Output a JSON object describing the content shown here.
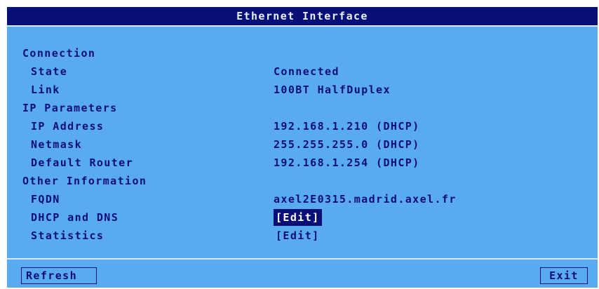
{
  "window": {
    "title": "Ethernet Interface"
  },
  "sections": {
    "connection": {
      "heading": "Connection",
      "state_label": "State",
      "state_value": "Connected",
      "link_label": "Link",
      "link_value": "100BT HalfDuplex"
    },
    "ip_parameters": {
      "heading": "IP Parameters",
      "ip_label": "IP Address",
      "ip_value": "192.168.1.210 (DHCP)",
      "netmask_label": "Netmask",
      "netmask_value": "255.255.255.0 (DHCP)",
      "router_label": "Default Router",
      "router_value": "192.168.1.254 (DHCP)"
    },
    "other": {
      "heading": "Other Information",
      "fqdn_label": "FQDN",
      "fqdn_value": "axel2E0315.madrid.axel.fr",
      "dhcp_dns_label": "DHCP and DNS",
      "dhcp_dns_button": "[Edit]",
      "statistics_label": "Statistics",
      "statistics_button": "[Edit]"
    }
  },
  "footer": {
    "refresh_label": "Refresh",
    "exit_label": "Exit"
  },
  "colors": {
    "background": "#5aaaf0",
    "foreground": "#0a0f78",
    "focus": "#0a0f78"
  }
}
